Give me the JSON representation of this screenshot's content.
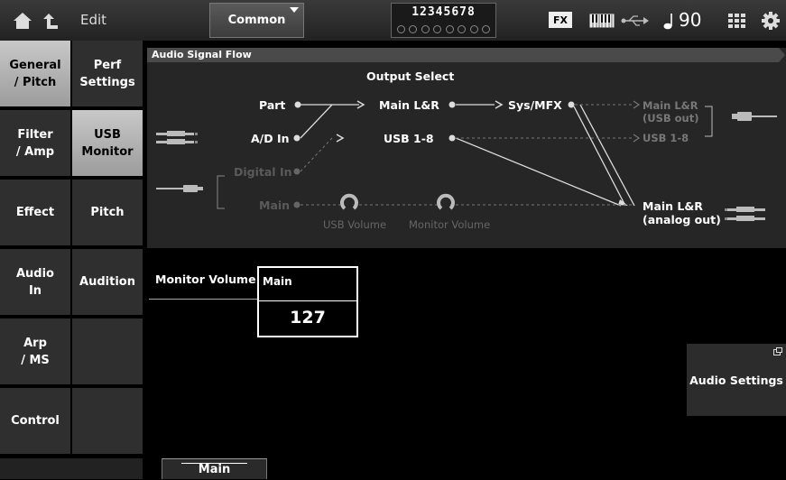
{
  "topbar": {
    "edit_label": "Edit",
    "common_label": "Common",
    "part_numbers": "12345678",
    "fx_badge": "FX",
    "tempo": "90",
    "icons": [
      "home-icon",
      "up-arrow-icon",
      "keyboard-icon",
      "usb-icon",
      "note-icon",
      "grid-icon",
      "gear-icon"
    ]
  },
  "nav": {
    "categories": [
      "General / Pitch",
      "Filter / Amp",
      "Effect",
      "Audio In",
      "Arp / MS",
      "Control"
    ],
    "active_category": "General / Pitch",
    "subs": [
      "Perf Settings",
      "USB Monitor",
      "Pitch",
      "Audition"
    ],
    "active_sub": "USB Monitor"
  },
  "flow": {
    "title": "Audio Signal Flow",
    "output_select": "Output Select",
    "inputs": {
      "part": "Part",
      "ad_in": "A/D In",
      "digital_in": "Digital In",
      "main": "Main"
    },
    "mid": {
      "main_lr": "Main L&R",
      "usb_1_8": "USB 1-8"
    },
    "sys_mfx": "Sys/MFX",
    "outputs": {
      "main_lr_usb": "Main L&R",
      "usb_out": "(USB out)",
      "usb_1_8": "USB 1-8",
      "main_lr_analog": "Main L&R",
      "analog_out": "(analog out)"
    },
    "knobs": {
      "usb_volume": "USB Volume",
      "monitor_volume": "Monitor Volume"
    }
  },
  "monitor_volume": {
    "label": "Monitor Volume",
    "tab": "Main",
    "value": "127"
  },
  "audio_settings_label": "Audio Settings",
  "bottom_tab": "Main"
}
